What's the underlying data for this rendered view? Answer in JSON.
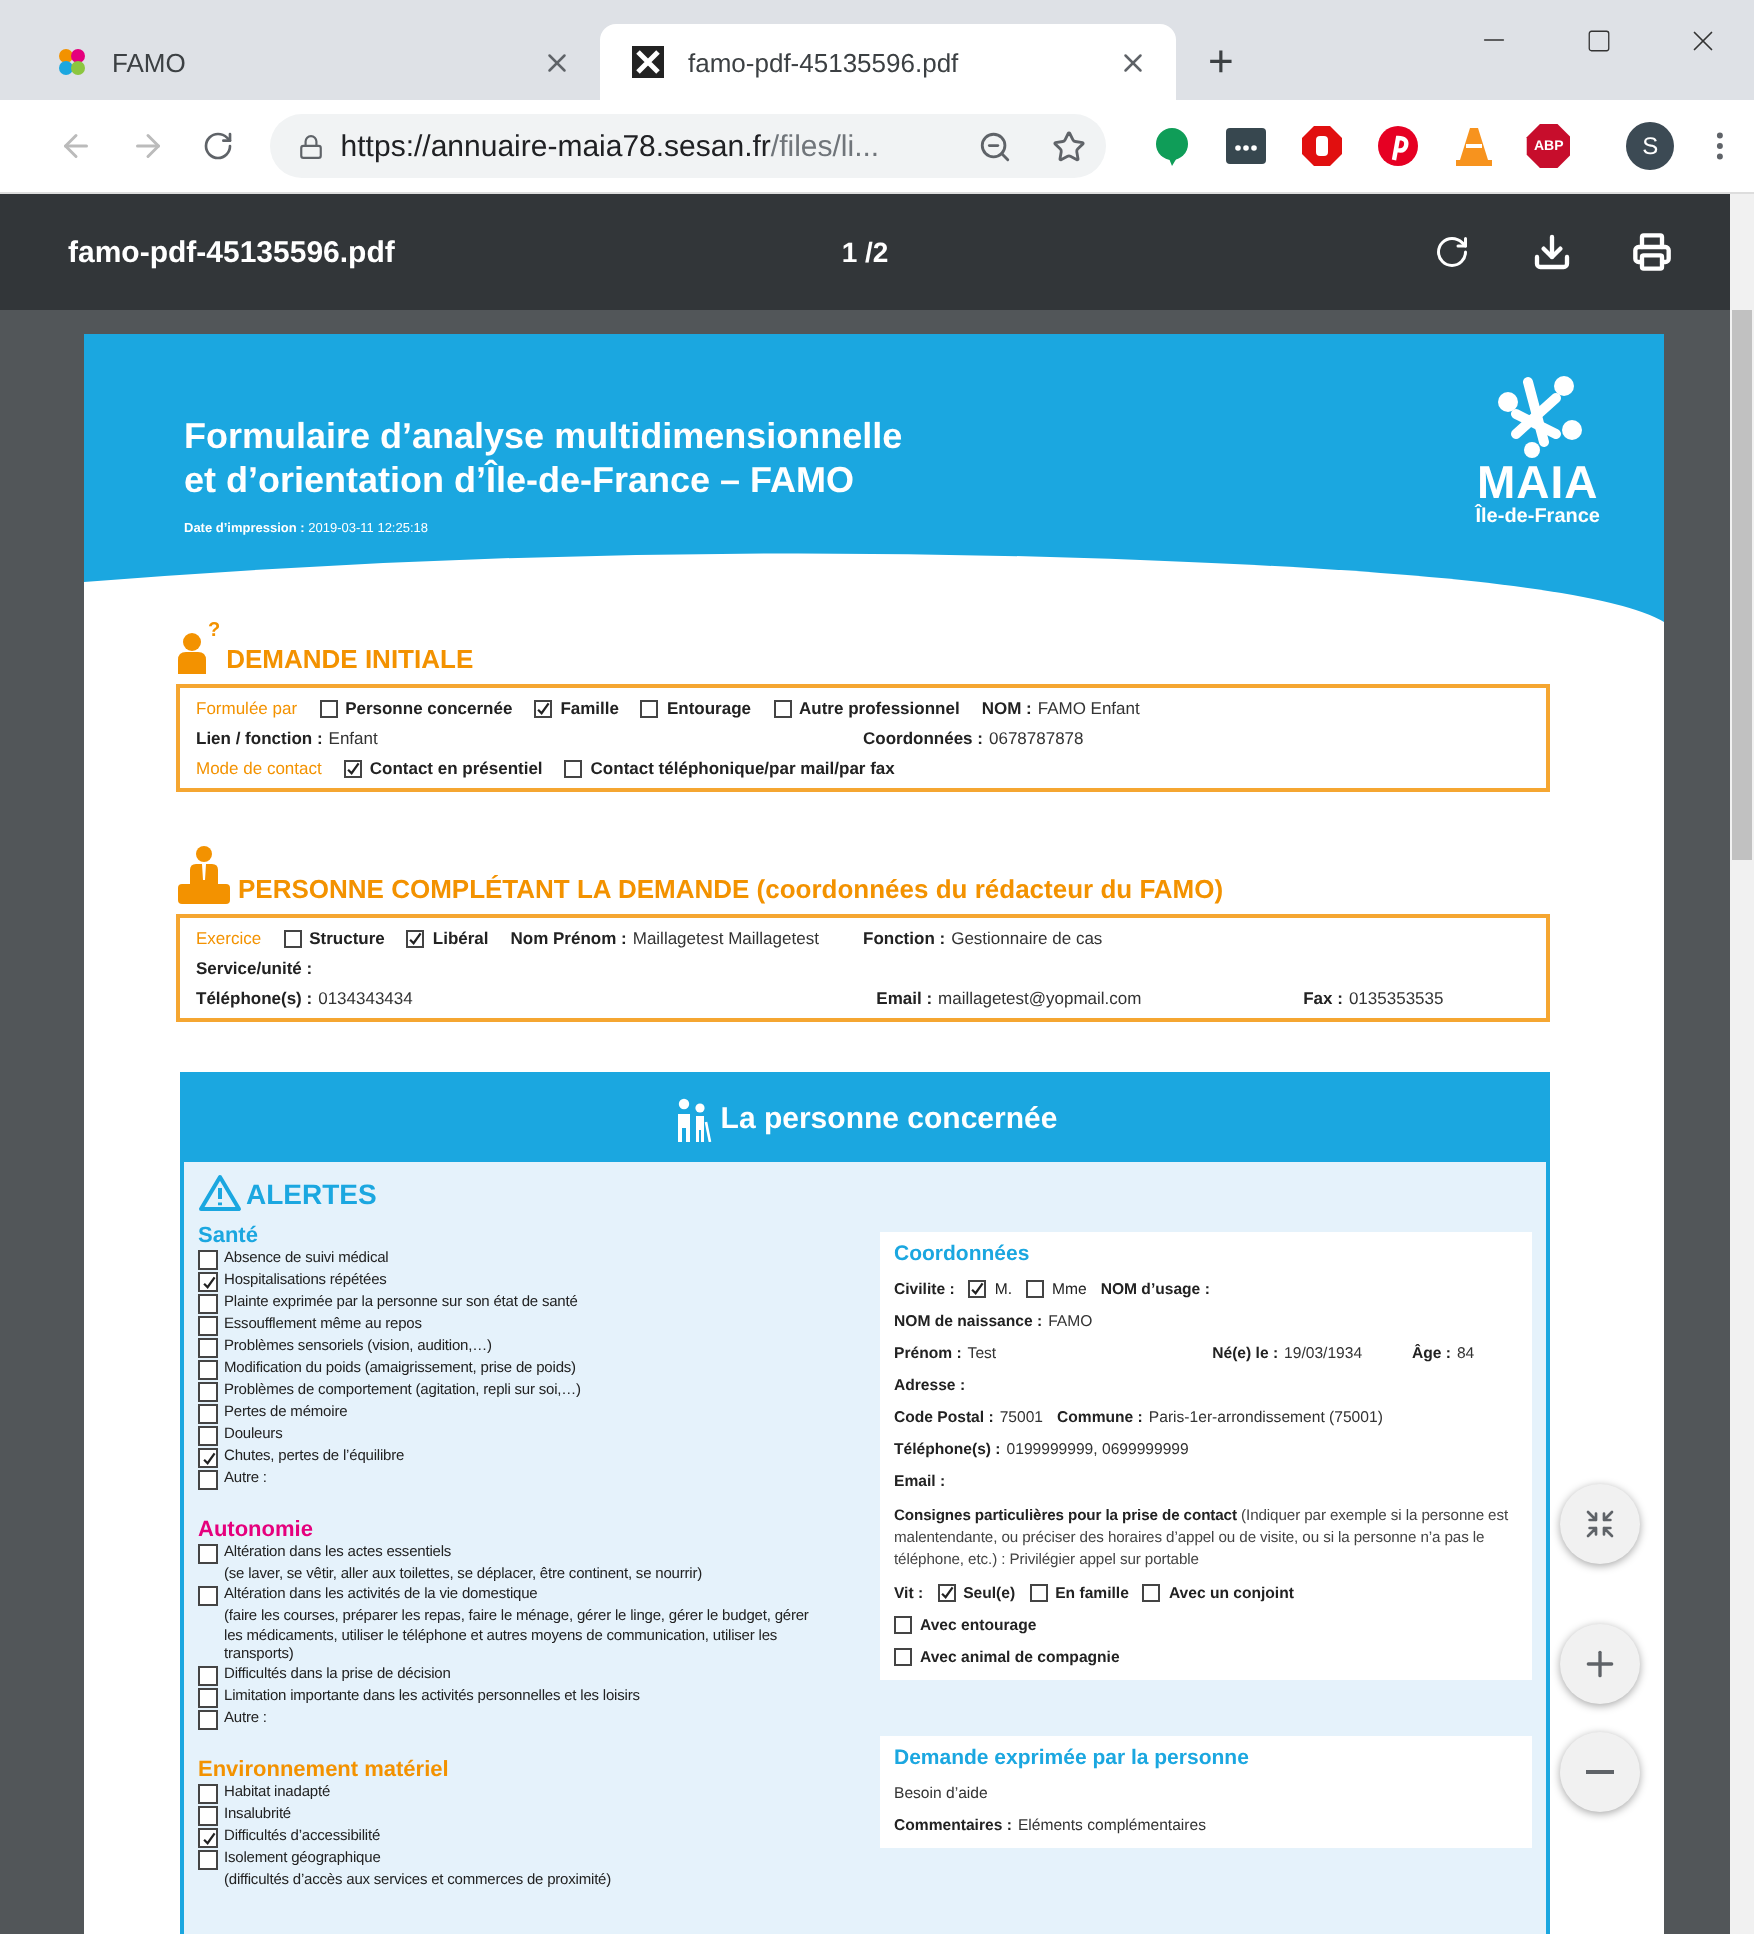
{
  "browser": {
    "tabs": [
      {
        "title": "FAMO",
        "selected": false
      },
      {
        "title": "famo-pdf-45135596.pdf",
        "selected": true
      }
    ],
    "new_tab": "+",
    "url": {
      "host": "https://annuaire-maia78.sesan.fr",
      "path": "/files/li..."
    },
    "extension_label": "ABP",
    "profile_initial": "S"
  },
  "pdf_toolbar": {
    "filename": "famo-pdf-45135596.pdf",
    "page": "1 /2"
  },
  "document": {
    "title_lines": [
      "Formulaire d’analyse multidimensionnelle",
      "et d’orientation d’Île-de-France – FAMO"
    ],
    "print_date": "**Date d’impression :** 2019-03-11 12:25:18",
    "logo": {
      "name": "MAIA",
      "region": "Île-de-France"
    },
    "sections": [
      {
        "title": "DEMANDE INITIALE",
        "badge": "?",
        "rows": [
          {
            "cells": [
              [
                {
                  "kind": "label",
                  "text": "Formulée par"
                },
                {
                  "kind": "check",
                  "text": "Personne concernée",
                  "checked": false
                },
                {
                  "kind": "check",
                  "text": "Famille",
                  "checked": true
                },
                {
                  "kind": "check",
                  "text": "Entourage",
                  "checked": false
                },
                {
                  "kind": "check",
                  "text": "Autre professionnel",
                  "checked": false
                },
                {
                  "kind": "field",
                  "label": "NOM :",
                  "value": "FAMO Enfant"
                }
              ]
            ]
          },
          {
            "cells": [
              [
                {
                  "kind": "field",
                  "label": "Lien / fonction :",
                  "value": "Enfant"
                }
              ],
              [
                {
                  "kind": "field",
                  "label": "Coordonnées :",
                  "value": "0678787878"
                }
              ]
            ]
          },
          {
            "cells": [
              [
                {
                  "kind": "label",
                  "text": "Mode de contact"
                },
                {
                  "kind": "check",
                  "text": "Contact en présentiel",
                  "checked": true
                },
                {
                  "kind": "check",
                  "text": "Contact téléphonique/par mail/par fax",
                  "checked": false
                }
              ]
            ]
          }
        ]
      },
      {
        "title": "PERSONNE COMPLÉTANT LA DEMANDE (coordonnées du rédacteur du FAMO)",
        "rows": [
          {
            "cells": [
              [
                {
                  "kind": "label",
                  "text": "Exercice"
                },
                {
                  "kind": "check",
                  "text": "Structure",
                  "checked": false
                },
                {
                  "kind": "check",
                  "text": "Libéral",
                  "checked": true
                },
                {
                  "kind": "field",
                  "label": "Nom Prénom :",
                  "value": "Maillagetest Maillagetest"
                }
              ],
              [
                {
                  "kind": "field",
                  "label": "Fonction :",
                  "value": "Gestionnaire de cas"
                }
              ]
            ]
          },
          {
            "cells": [
              [
                {
                  "kind": "field",
                  "label": "Service/unité :"
                }
              ]
            ]
          },
          {
            "cells": [
              [
                {
                  "kind": "field",
                  "label": "Téléphone(s) :",
                  "value": "0134343434"
                }
              ],
              [
                {
                  "kind": "field",
                  "label": "Email :",
                  "value": "maillagetest@yopmail.com"
                }
              ],
              [
                {
                  "kind": "field",
                  "label": "Fax :",
                  "value": "0135353535"
                }
              ]
            ]
          }
        ]
      }
    ],
    "person": {
      "title": "La personne concernée",
      "alerts": {
        "title": "ALERTES",
        "groups": [
          {
            "title": "Santé",
            "color": "#1ba7e0",
            "items": [
              {
                "text": "Absence de suivi médical",
                "checked": false
              },
              {
                "text": "Hospitalisations répétées",
                "checked": true
              },
              {
                "text": "Plainte exprimée par la personne sur son état de santé",
                "checked": false
              },
              {
                "text": "Essoufflement même au repos",
                "checked": false
              },
              {
                "text": "Problèmes sensoriels (vision, audition,…)",
                "checked": false
              },
              {
                "text": "Modification du poids (amaigrissement, prise de poids)",
                "checked": false
              },
              {
                "text": "Problèmes de comportement (agitation, repli sur soi,…)",
                "checked": false
              },
              {
                "text": "Pertes de mémoire",
                "checked": false
              },
              {
                "text": "Douleurs",
                "checked": false
              },
              {
                "text": "Chutes, pertes de l’équilibre",
                "checked": true
              },
              {
                "text": "Autre :",
                "checked": false
              }
            ]
          },
          {
            "title": "Autonomie",
            "color": "#e5007d",
            "items": [
              {
                "text": "Altération dans les actes essentiels",
                "checked": false,
                "detail": "(se laver, se vêtir, aller aux toilettes, se déplacer, être continent, se nourrir)"
              },
              {
                "text": "Altération dans les activités de la vie domestique",
                "checked": false,
                "detail": "(faire les courses, préparer les repas, faire le ménage, gérer le linge, gérer le budget, gérer les médicaments, utiliser le téléphone et autres moyens de communication, utiliser les transports)"
              },
              {
                "text": "Difficultés dans la prise de décision",
                "checked": false
              },
              {
                "text": "Limitation importante dans les activités personnelles et les loisirs",
                "checked": false
              },
              {
                "text": "Autre :",
                "checked": false
              }
            ]
          },
          {
            "title": "Environnement matériel",
            "color": "#f39200",
            "items": [
              {
                "text": "Habitat inadapté",
                "checked": false
              },
              {
                "text": "Insalubrité",
                "checked": false
              },
              {
                "text": "Difficultés d’accessibilité",
                "checked": true
              },
              {
                "text": "Isolement géographique",
                "checked": false,
                "detail": "(difficultés d’accès aux services et commerces de proximité)"
              }
            ]
          }
        ]
      },
      "cards": [
        {
          "title": "Coordonnées",
          "rows": [
            {
              "cells": [
                [
                  {
                    "kind": "field",
                    "label": "Civilite :"
                  },
                  {
                    "kind": "choice",
                    "text": "M.",
                    "checked": true
                  },
                  {
                    "kind": "choice",
                    "text": "Mme",
                    "checked": false
                  },
                  {
                    "kind": "field",
                    "label": "NOM d’usage :"
                  }
                ]
              ]
            },
            {
              "cells": [
                [
                  {
                    "kind": "field",
                    "label": "NOM de naissance :",
                    "value": "FAMO"
                  }
                ]
              ]
            },
            {
              "cells": [
                [
                  {
                    "kind": "field",
                    "label": "Prénom :",
                    "value": "Test"
                  }
                ],
                [
                  {
                    "kind": "field",
                    "label": "Né(e) le :",
                    "value": "19/03/1934"
                  }
                ],
                [
                  {
                    "kind": "field",
                    "label": "Âge :",
                    "value": "84"
                  }
                ]
              ]
            },
            {
              "cells": [
                [
                  {
                    "kind": "field",
                    "label": "Adresse :"
                  }
                ]
              ]
            },
            {
              "cells": [
                [
                  {
                    "kind": "field",
                    "label": "Code Postal :",
                    "value": "75001"
                  },
                  {
                    "kind": "field",
                    "label": "Commune :",
                    "value": "Paris-1er-arrondissement (75001)"
                  }
                ]
              ]
            },
            {
              "cells": [
                [
                  {
                    "kind": "field",
                    "label": "Téléphone(s) :",
                    "value": "0199999999,  0699999999"
                  }
                ]
              ]
            },
            {
              "cells": [
                [
                  {
                    "kind": "field",
                    "label": "Email :"
                  }
                ]
              ]
            },
            {
              "cells": [
                [
                  {
                    "kind": "text",
                    "text": "**Consignes particulières pour la prise de contact** (Indiquer par exemple si la personne est malentendante, ou préciser des horaires d’appel ou de visite, ou si la personne n’a pas le téléphone, etc.) : Privilégier appel sur portable"
                  }
                ]
              ]
            },
            {
              "cells": [
                [
                  {
                    "kind": "field",
                    "label": "Vit :"
                  },
                  {
                    "kind": "check",
                    "text": "Seul(e)",
                    "checked": true
                  },
                  {
                    "kind": "check",
                    "text": "En famille",
                    "checked": false
                  },
                  {
                    "kind": "check",
                    "text": "Avec un conjoint",
                    "checked": false
                  }
                ]
              ]
            },
            {
              "cells": [
                [
                  {
                    "kind": "check",
                    "text": "Avec entourage",
                    "checked": false
                  }
                ]
              ]
            },
            {
              "cells": [
                [
                  {
                    "kind": "check",
                    "text": "Avec animal de compagnie",
                    "checked": false
                  }
                ]
              ]
            }
          ]
        },
        {
          "title": "Demande exprimée par la personne",
          "rows": [
            {
              "cells": [
                [
                  {
                    "kind": "plain",
                    "text": "Besoin d’aide"
                  }
                ]
              ]
            },
            {
              "cells": [
                [
                  {
                    "kind": "field",
                    "label": "Commentaires :",
                    "value": "Eléments complémentaires"
                  }
                ]
              ]
            }
          ]
        }
      ]
    }
  }
}
